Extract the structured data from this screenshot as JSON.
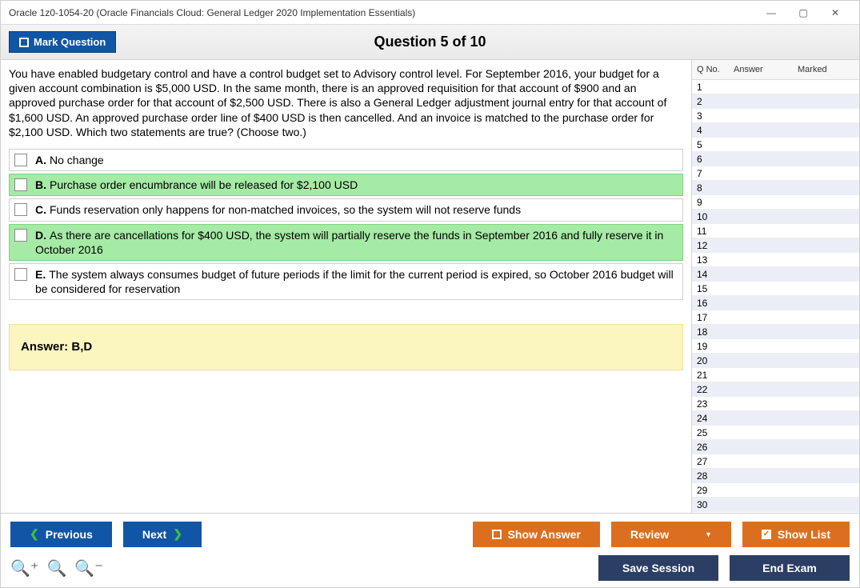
{
  "window": {
    "title": "Oracle 1z0-1054-20 (Oracle Financials Cloud: General Ledger 2020 Implementation Essentials)"
  },
  "header": {
    "mark_label": "Mark Question",
    "question_title": "Question 5 of 10"
  },
  "question": {
    "text": "You have enabled budgetary control and have a control budget set to Advisory control level. For September 2016, your budget for a given account combination is $5,000 USD. In the same month, there is an approved requisition for that account of $900 and an approved purchase order for that account of $2,500 USD. There is also a General Ledger adjustment journal entry for that account of $1,600 USD. An approved purchase order line of $400 USD is then cancelled. And an invoice is matched to the purchase order for $2,100 USD. Which two statements are true? (Choose two.)",
    "options": [
      {
        "letter": "A.",
        "text": "No change",
        "correct": false
      },
      {
        "letter": "B.",
        "text": "Purchase order encumbrance will be released for $2,100 USD",
        "correct": true
      },
      {
        "letter": "C.",
        "text": "Funds reservation only happens for non-matched invoices, so the system will not reserve funds",
        "correct": false
      },
      {
        "letter": "D.",
        "text": "As there are cancellations for $400 USD, the system will partially reserve the funds in September 2016 and fully reserve it in October 2016",
        "correct": true
      },
      {
        "letter": "E.",
        "text": "The system always consumes budget of future periods if the limit for the current period is expired, so October 2016 budget will be considered for reservation",
        "correct": false
      }
    ],
    "answer_label": "Answer:",
    "answer_value": "B,D"
  },
  "sidebar": {
    "head": {
      "qno": "Q No.",
      "answer": "Answer",
      "marked": "Marked"
    },
    "count": 30
  },
  "footer": {
    "prev": "Previous",
    "next": "Next",
    "show_answer": "Show Answer",
    "review": "Review",
    "show_list": "Show List",
    "save_session": "Save Session",
    "end_exam": "End Exam"
  }
}
